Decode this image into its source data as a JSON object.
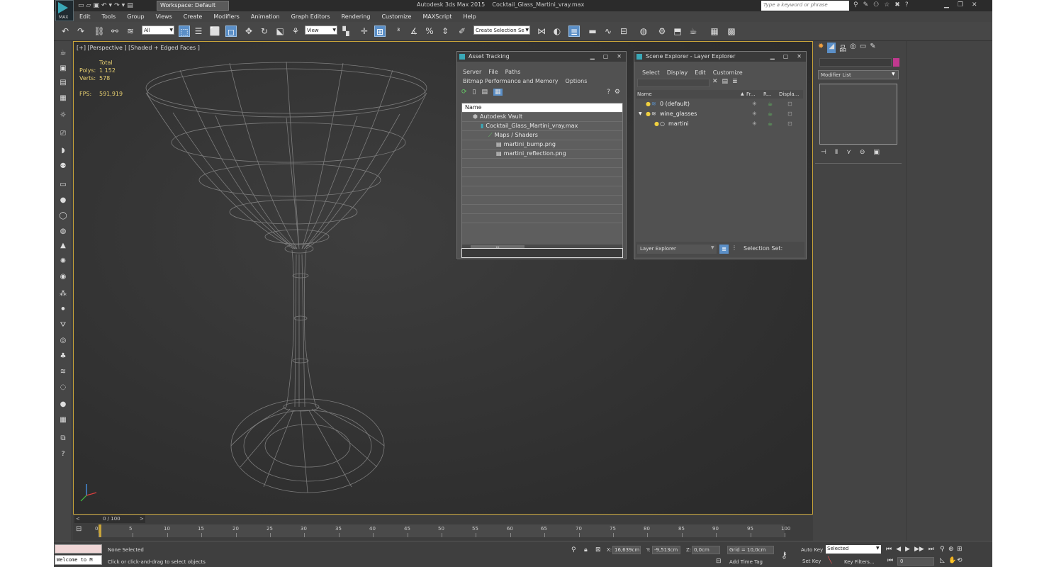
{
  "titlebar": {
    "workspace": "Workspace: Default",
    "title": "Autodesk 3ds Max 2015    Cocktail_Glass_Martini_vray.max",
    "search_placeholder": "Type a keyword or phrase",
    "logo_text": "MAX"
  },
  "menu": [
    "Edit",
    "Tools",
    "Group",
    "Views",
    "Create",
    "Modifiers",
    "Animation",
    "Graph Editors",
    "Rendering",
    "Customize",
    "MAXScript",
    "Help"
  ],
  "toolbar": {
    "filter_combo": "All",
    "view_combo": "View",
    "selection_set": "Create Selection Se"
  },
  "viewport": {
    "label": "[+] [Perspective ] [Shaded + Edged Faces ]",
    "stats_total": "Total",
    "polys_label": "Polys:",
    "polys_value": "1 152",
    "verts_label": "Verts:",
    "verts_value": "578",
    "fps_label": "FPS:",
    "fps_value": "591,919"
  },
  "asset_tracking": {
    "title": "Asset Tracking",
    "menu": [
      "Server",
      "File",
      "Paths",
      "Bitmap Performance and Memory",
      "Options"
    ],
    "column": "Name",
    "rows": [
      {
        "indent": 1,
        "icon": "vault-icon",
        "name": "Autodesk Vault"
      },
      {
        "indent": 2,
        "icon": "max-file-icon",
        "name": "Cocktail_Glass_Martini_vray.max"
      },
      {
        "indent": 3,
        "icon": "maps-icon",
        "name": "Maps / Shaders"
      },
      {
        "indent": 4,
        "icon": "image-file-icon",
        "name": "martini_bump.png"
      },
      {
        "indent": 4,
        "icon": "image-file-icon",
        "name": "martini_reflection.png"
      }
    ],
    "scroll_mark": "III"
  },
  "scene_explorer": {
    "title": "Scene Explorer - Layer Explorer",
    "menu": [
      "Select",
      "Display",
      "Edit",
      "Customize"
    ],
    "columns": [
      "Name",
      "Fr...",
      "R...",
      "Displa..."
    ],
    "rows": [
      {
        "name": "0 (default)",
        "expander": ""
      },
      {
        "name": "wine_glasses",
        "expander": "▼"
      },
      {
        "name": "martini",
        "expander": ""
      }
    ],
    "footer_combo": "Layer Explorer",
    "footer_label": "Selection Set:"
  },
  "command_panel": {
    "modifier_list": "Modifier List",
    "color_swatch": "#c0398f"
  },
  "timeline": {
    "frame_label": "0 / 100",
    "ticks": [
      "0",
      "5",
      "10",
      "15",
      "20",
      "25",
      "30",
      "35",
      "40",
      "45",
      "50",
      "55",
      "60",
      "65",
      "70",
      "75",
      "80",
      "85",
      "90",
      "95",
      "100"
    ]
  },
  "status": {
    "maxscript_listener": "Welcome to M",
    "selection": "None Selected",
    "prompt": "Click or click-and-drag to select objects",
    "x_label": "X:",
    "x_value": "16,639cm",
    "y_label": "Y:",
    "y_value": "-9,513cm",
    "z_label": "Z:",
    "z_value": "0,0cm",
    "grid": "Grid = 10,0cm",
    "auto_key": "Auto Key",
    "set_key": "Set Key",
    "selected_combo": "Selected",
    "key_filters": "Key Filters...",
    "add_time_tag": "Add Time Tag",
    "frame_value": "0"
  },
  "colors": {
    "viewport_border": "#c8a43a",
    "accent": "#3aa8b7",
    "stats_text": "#e8d070"
  }
}
